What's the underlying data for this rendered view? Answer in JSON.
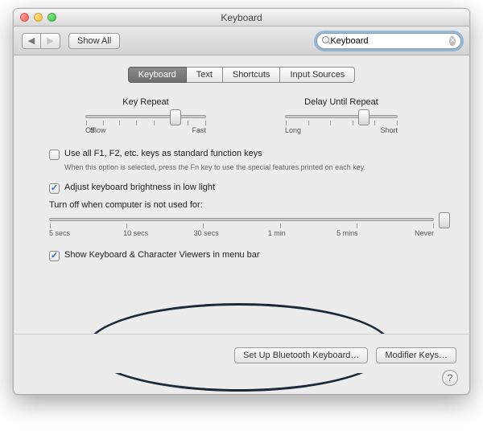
{
  "window": {
    "title": "Keyboard"
  },
  "toolbar": {
    "show_all": "Show All",
    "search_value": "Keyboard"
  },
  "tabs": [
    "Keyboard",
    "Text",
    "Shortcuts",
    "Input Sources"
  ],
  "sliders": {
    "key_repeat": {
      "label": "Key Repeat",
      "left": "Off",
      "left2": "Slow",
      "right": "Fast"
    },
    "delay_repeat": {
      "label": "Delay Until Repeat",
      "left": "Long",
      "right": "Short"
    }
  },
  "options": {
    "fn_keys": {
      "label": "Use all F1, F2, etc. keys as standard function keys",
      "help": "When this option is selected, press the Fn key to use the special features printed on each key."
    },
    "brightness": {
      "label": "Adjust keyboard brightness in low light"
    },
    "turnoff": {
      "label": "Turn off when computer is not used for:",
      "ticks": [
        "5 secs",
        "10 secs",
        "30 secs",
        "1 min",
        "5 mins",
        "Never"
      ]
    },
    "show_viewers": {
      "label": "Show Keyboard & Character Viewers in menu bar"
    }
  },
  "buttons": {
    "bluetooth": "Set Up Bluetooth Keyboard…",
    "modifier": "Modifier Keys…"
  }
}
